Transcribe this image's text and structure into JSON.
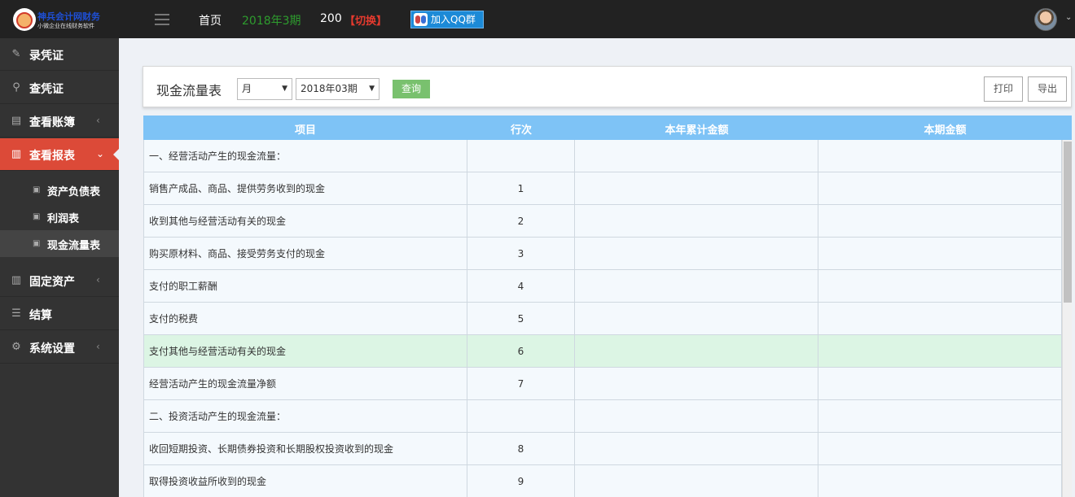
{
  "topbar": {
    "logo_title": "神兵会计网财务",
    "logo_subtitle": "小微企业在线财务软件",
    "home": "首页",
    "period": "2018年3期",
    "count": "200",
    "switch": "【切换】",
    "qq_button": "加入QQ群"
  },
  "sidebar": {
    "items": [
      {
        "label": "录凭证",
        "icon": "edit-icon"
      },
      {
        "label": "查凭证",
        "icon": "search-icon"
      },
      {
        "label": "查看账簿",
        "icon": "book-icon"
      },
      {
        "label": "查看报表",
        "icon": "bar-chart-icon"
      },
      {
        "label": "固定资产",
        "icon": "bar-chart-icon"
      },
      {
        "label": "结算",
        "icon": "list-icon"
      },
      {
        "label": "系统设置",
        "icon": "gear-icon"
      }
    ],
    "sub_items": [
      {
        "label": "资产负债表"
      },
      {
        "label": "利润表"
      },
      {
        "label": "现金流量表"
      }
    ]
  },
  "panel": {
    "title": "现金流量表",
    "period_type": "月",
    "period_value": "2018年03期",
    "query_label": "查询",
    "print_label": "打印",
    "export_label": "导出"
  },
  "table": {
    "columns": [
      "项目",
      "行次",
      "本年累计金额",
      "本期金额"
    ],
    "rows": [
      {
        "item": "一、经营活动产生的现金流量：",
        "line": ""
      },
      {
        "item": "销售产成品、商品、提供劳务收到的现金",
        "line": "1"
      },
      {
        "item": "收到其他与经营活动有关的现金",
        "line": "2"
      },
      {
        "item": "购买原材料、商品、接受劳务支付的现金",
        "line": "3"
      },
      {
        "item": "支付的职工薪酬",
        "line": "4"
      },
      {
        "item": "支付的税费",
        "line": "5"
      },
      {
        "item": "支付其他与经营活动有关的现金",
        "line": "6"
      },
      {
        "item": "经营活动产生的现金流量净额",
        "line": "7"
      },
      {
        "item": "二、投资活动产生的现金流量：",
        "line": ""
      },
      {
        "item": "收回短期投资、长期债券投资和长期股权投资收到的现金",
        "line": "8"
      },
      {
        "item": "取得投资收益所收到的现金",
        "line": "9"
      }
    ]
  },
  "colors": {
    "topbar_bg": "#222222",
    "sidebar_bg": "#333333",
    "active_menu": "#dc4a38",
    "table_header": "#7ec3f6",
    "query_button": "#79c16e",
    "period_text": "#2e9c2e",
    "switch_text": "#e63a2e"
  }
}
